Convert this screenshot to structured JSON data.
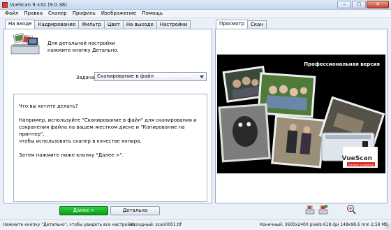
{
  "window": {
    "title": "VueScan 9 x32 (9.0.38)",
    "minimize": "–",
    "maximize": "□",
    "close": "✕"
  },
  "menu": [
    "Файл",
    "Правка",
    "Сканер",
    "Профиль",
    "Изображение",
    "Помощь"
  ],
  "left_tabs": [
    "На входе",
    "Кадрирование",
    "Фильтр",
    "Цвет",
    "На выходе",
    "Настройки"
  ],
  "left_active_tab": "На входе",
  "intro": {
    "line1": "Для детальной настройки",
    "line2": "нажмите кнопку Детально."
  },
  "task": {
    "label": "Задача:",
    "value": "Сканирование в файл"
  },
  "help": {
    "p1": "Что вы хотите делать?",
    "p2a": "Например, используйте \"Сканирование в файл\" для сканирования и",
    "p2b": "сохранения файла на вашем жестком диске и \"Копирование на принтер\",",
    "p2c": "чтобы использовать сканер в качестве копира.",
    "p3": "Затем нажмите ниже кнопку \"Далее >\"."
  },
  "buttons": {
    "next": "Далее >",
    "detail": "Детально"
  },
  "right_tabs": [
    "Просмотр",
    "Скан"
  ],
  "right_active_tab": "Просмотр",
  "preview": {
    "pro_label": "Профессиональная версия",
    "logo": "VueScan",
    "logo_sub": "the best in scanning"
  },
  "toolbar_icons": [
    "scan-preview-icon",
    "scan-save-icon",
    "zoom-in-icon"
  ],
  "status": {
    "left": "Нажмите кнопку \"Детально\", чтобы увидеть все настройки",
    "middle": "Исходный: scan0001.tif",
    "right": "Конечный: 3600x2400 pixels 618 dpi 148x98.6 mm 2.59 MB"
  },
  "colors": {
    "accent_green": "#0d9b1b",
    "title_red": "#e23b2c"
  }
}
